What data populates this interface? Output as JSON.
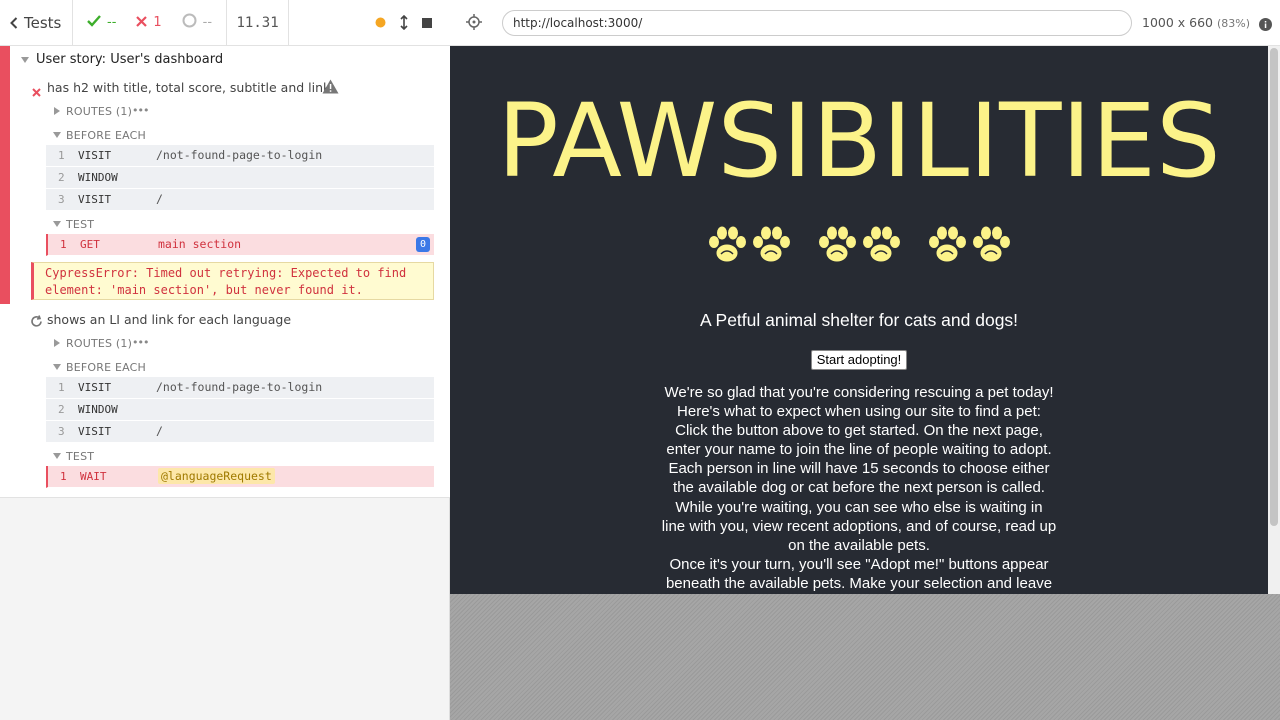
{
  "reporter": {
    "back_label": "Tests",
    "stats": {
      "passed": "--",
      "failed": "1",
      "pending": "--"
    },
    "duration": "11.31"
  },
  "suite": {
    "title": "User story: User's dashboard",
    "tests": [
      {
        "title": "has h2 with title, total score, subtitle and link",
        "state": "failed",
        "routes_label": "ROUTES (1)",
        "before_each_label": "BEFORE EACH",
        "before_each": [
          {
            "num": "1",
            "name": "VISIT",
            "msg": "/not-found-page-to-login"
          },
          {
            "num": "2",
            "name": "WINDOW",
            "msg": ""
          },
          {
            "num": "3",
            "name": "VISIT",
            "msg": "/"
          }
        ],
        "test_label": "TEST",
        "test_cmds": [
          {
            "num": "1",
            "name": "GET",
            "msg": "main section",
            "badge": "0"
          }
        ],
        "error": "CypressError: Timed out retrying: Expected to find element: 'main section', but never found it."
      },
      {
        "title": "shows an LI and link for each language",
        "state": "running",
        "routes_label": "ROUTES (1)",
        "before_each_label": "BEFORE EACH",
        "before_each": [
          {
            "num": "1",
            "name": "VISIT",
            "msg": "/not-found-page-to-login"
          },
          {
            "num": "2",
            "name": "WINDOW",
            "msg": ""
          },
          {
            "num": "3",
            "name": "VISIT",
            "msg": "/"
          }
        ],
        "test_label": "TEST",
        "test_cmds": [
          {
            "num": "1",
            "name": "WAIT",
            "msg": "@languageRequest"
          }
        ]
      }
    ]
  },
  "aut": {
    "url": "http://localhost:3000/",
    "viewport": "1000 x 660",
    "scale": "(83%)",
    "app": {
      "title": "PAWSIBILITIES",
      "subtitle": "A Petful animal shelter for cats and dogs!",
      "start_button": "Start adopting!",
      "intro_lines": [
        "We're so glad that you're considering rescuing a pet today!",
        "Here's what to expect when using our site to find a pet:",
        "Click the button above to get started. On the next page,",
        "enter your name to join the line of people waiting to adopt.",
        "Each person in line will have 15 seconds to choose either",
        "the available dog or cat before the next person is called.",
        "While you're waiting, you can see who else is waiting in",
        "line with you, view recent adoptions, and of course, read up",
        "on the available pets.",
        "Once it's your turn, you'll see \"Adopt me!\" buttons appear",
        "beneath the available pets. Make your selection and leave"
      ]
    }
  },
  "colors": {
    "accent_fail": "#e94f5f",
    "accent_pass": "#3dae2b",
    "app_bg": "#272b33",
    "app_title": "#fcf389"
  }
}
